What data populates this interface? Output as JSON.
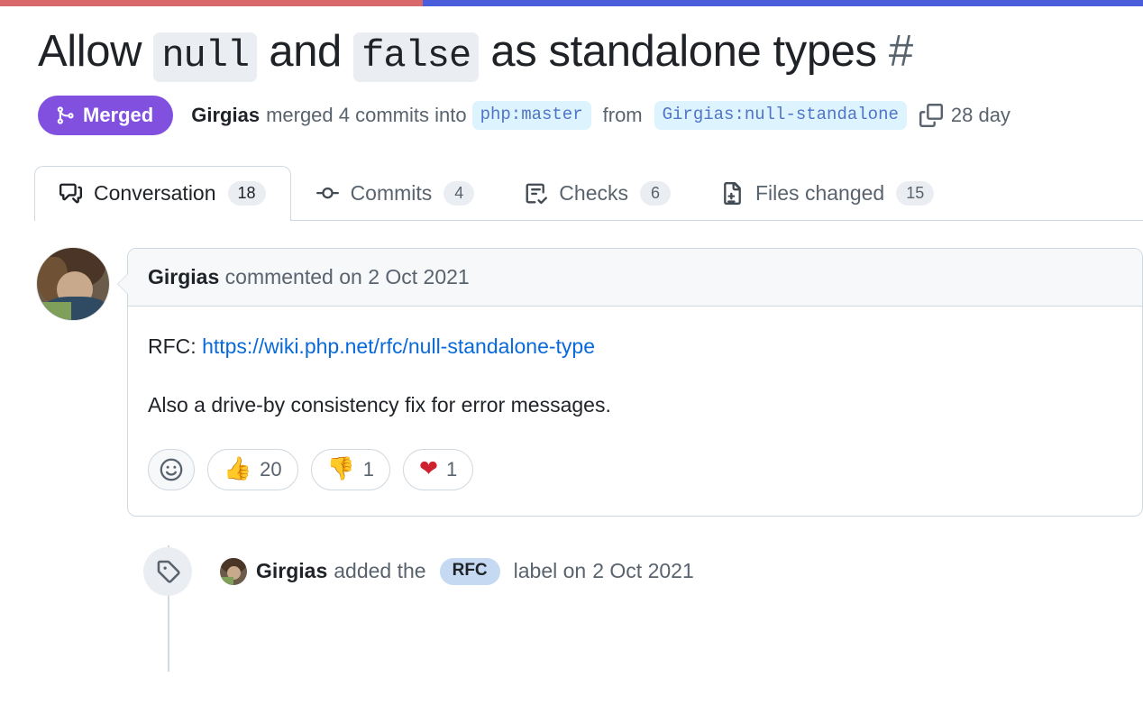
{
  "progress": {
    "name": "page-load-progress",
    "percent": 37,
    "done_color": "#d9686b",
    "rest_color": "#4a5ddb"
  },
  "pull_request": {
    "title_parts": {
      "p1": "Allow ",
      "code1": "null",
      "p2": " and ",
      "code2": "false",
      "p3": " as standalone types ",
      "number": "#"
    },
    "state": "Merged",
    "state_color": "#8250df",
    "author": "Girgias",
    "merge_text_1": "merged 4 commits into",
    "base_branch": "php:master",
    "merge_text_2": "from",
    "head_branch": "Girgias:null-standalone",
    "age": "28 day"
  },
  "tabs": [
    {
      "label": "Conversation",
      "count": "18",
      "icon": "comment-discussion-icon",
      "selected": true
    },
    {
      "label": "Commits",
      "count": "4",
      "icon": "git-commit-icon",
      "selected": false
    },
    {
      "label": "Checks",
      "count": "6",
      "icon": "checklist-icon",
      "selected": false
    },
    {
      "label": "Files changed",
      "count": "15",
      "icon": "file-diff-icon",
      "selected": false
    }
  ],
  "comment": {
    "author": "Girgias",
    "action": "commented on",
    "date": "2 Oct 2021",
    "paragraph_1_prefix": "RFC: ",
    "paragraph_1_link": "https://wiki.php.net/rfc/null-standalone-type",
    "paragraph_2": "Also a drive-by consistency fix for error messages.",
    "reactions": [
      {
        "name": "add-reaction",
        "emoji": "☺",
        "count": ""
      },
      {
        "name": "thumbs-up",
        "emoji": "👍",
        "count": "20"
      },
      {
        "name": "thumbs-down",
        "emoji": "👎",
        "count": "1"
      },
      {
        "name": "heart",
        "emoji": "❤",
        "count": "1"
      }
    ]
  },
  "timeline_event": {
    "icon": "tag-icon",
    "actor": "Girgias",
    "text_before": "added the",
    "label": "RFC",
    "label_color": "#c5d9f2",
    "text_after": "label on",
    "date": "2 Oct 2021"
  }
}
